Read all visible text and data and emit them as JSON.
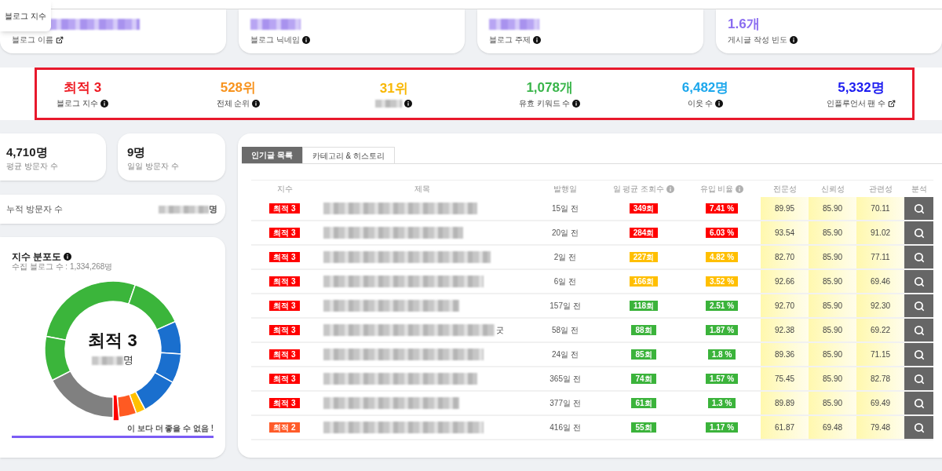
{
  "tooltip": {
    "text": "블로그 지수"
  },
  "blog_info": [
    {
      "label": "블로그 이름",
      "kind": "link",
      "redacted": true
    },
    {
      "label": "블로그 닉네임",
      "kind": "info",
      "redacted": true
    },
    {
      "label": "블로그 주제",
      "kind": "info",
      "redacted": true
    },
    {
      "value": "1.6개",
      "label": "게시글 작성 빈도",
      "kind": "info",
      "redacted": false
    }
  ],
  "stats": [
    {
      "value": "최적 3",
      "label": "블로그 지수",
      "color": "#ee1c24",
      "kind": "info",
      "redacted": false
    },
    {
      "value": "528위",
      "label": "전체 순위",
      "color": "#f7931e",
      "kind": "info",
      "redacted": false
    },
    {
      "value": "31위",
      "color": "#f8b704",
      "kind": "info",
      "redacted": true
    },
    {
      "value": "1,078개",
      "label": "유효 키워드 수",
      "color": "#39b54a",
      "kind": "info",
      "redacted": false
    },
    {
      "value": "6,482명",
      "label": "이웃 수",
      "color": "#1ca7ec",
      "kind": "info",
      "redacted": false
    },
    {
      "value": "5,332명",
      "label": "인플루언서 팬 수",
      "color": "#1b1bf0",
      "kind": "link",
      "redacted": false
    }
  ],
  "visitors": [
    {
      "value": "4,710명",
      "label": "평균 방문자 수"
    },
    {
      "value": "9명",
      "label": "일일 방문자 수"
    }
  ],
  "total_visitors": {
    "label": "누적 방문자 수",
    "unit": "명"
  },
  "distribution": {
    "title": "지수 분포도",
    "subtitle": "수집 블로그 수 : 1,334,268명",
    "center_title": "최적 3",
    "center_unit": "명",
    "message": "이 보다 더 좋을 수 없음 !",
    "level": 1
  },
  "tabs": [
    {
      "label": "인기글 목록",
      "selected": true
    },
    {
      "label": "카테고리 & 히스토리",
      "selected": false
    }
  ],
  "table": {
    "columns": [
      {
        "label": "지수",
        "info": false
      },
      {
        "label": "제목",
        "info": false
      },
      {
        "label": "발행일",
        "info": false
      },
      {
        "label": "일 평균 조회수",
        "info": true
      },
      {
        "label": "유입 비율",
        "info": true
      },
      {
        "label": "전문성",
        "info": false
      },
      {
        "label": "신뢰성",
        "info": false
      },
      {
        "label": "관련성",
        "info": false
      },
      {
        "label": "분석",
        "info": false
      }
    ],
    "rows": [
      {
        "grade": {
          "text": "최적 3",
          "color": "#ff0000"
        },
        "published": "15일 전",
        "views": {
          "text": "349회",
          "color": "#ff0000"
        },
        "ratio": {
          "text": "7.41 %",
          "color": "#ff0000"
        },
        "expertise": "89.95",
        "trust": "85.90",
        "relevance": "70.11"
      },
      {
        "grade": {
          "text": "최적 3",
          "color": "#ff0000"
        },
        "published": "20일 전",
        "views": {
          "text": "284회",
          "color": "#ff0000"
        },
        "ratio": {
          "text": "6.03 %",
          "color": "#ff0000"
        },
        "expertise": "93.54",
        "trust": "85.90",
        "relevance": "91.02"
      },
      {
        "grade": {
          "text": "최적 3",
          "color": "#ff0000"
        },
        "published": "2일 전",
        "views": {
          "text": "227회",
          "color": "#ffbf00"
        },
        "ratio": {
          "text": "4.82 %",
          "color": "#ffbf00"
        },
        "expertise": "82.70",
        "trust": "85.90",
        "relevance": "77.11"
      },
      {
        "grade": {
          "text": "최적 3",
          "color": "#ff0000"
        },
        "published": "6일 전",
        "views": {
          "text": "166회",
          "color": "#ffbf00"
        },
        "ratio": {
          "text": "3.52 %",
          "color": "#ffbf00"
        },
        "expertise": "92.66",
        "trust": "85.90",
        "relevance": "69.46"
      },
      {
        "grade": {
          "text": "최적 3",
          "color": "#ff0000"
        },
        "published": "157일 전",
        "views": {
          "text": "118회",
          "color": "#3bb33b"
        },
        "ratio": {
          "text": "2.51 %",
          "color": "#3bb33b"
        },
        "expertise": "92.70",
        "trust": "85.90",
        "relevance": "92.30"
      },
      {
        "grade": {
          "text": "최적 3",
          "color": "#ff0000"
        },
        "title": "굿",
        "published": "58일 전",
        "views": {
          "text": "88회",
          "color": "#3bb33b"
        },
        "ratio": {
          "text": "1.87 %",
          "color": "#3bb33b"
        },
        "expertise": "92.38",
        "trust": "85.90",
        "relevance": "69.22"
      },
      {
        "grade": {
          "text": "최적 3",
          "color": "#ff0000"
        },
        "published": "24일 전",
        "views": {
          "text": "85회",
          "color": "#3bb33b"
        },
        "ratio": {
          "text": "1.8 %",
          "color": "#3bb33b"
        },
        "expertise": "89.36",
        "trust": "85.90",
        "relevance": "71.15"
      },
      {
        "grade": {
          "text": "최적 3",
          "color": "#ff0000"
        },
        "published": "365일 전",
        "views": {
          "text": "74회",
          "color": "#3bb33b"
        },
        "ratio": {
          "text": "1.57 %",
          "color": "#3bb33b"
        },
        "expertise": "75.45",
        "trust": "85.90",
        "relevance": "82.78"
      },
      {
        "grade": {
          "text": "최적 3",
          "color": "#ff0000"
        },
        "published": "377일 전",
        "views": {
          "text": "61회",
          "color": "#3bb33b"
        },
        "ratio": {
          "text": "1.3 %",
          "color": "#3bb33b"
        },
        "expertise": "89.89",
        "trust": "85.90",
        "relevance": "69.49"
      },
      {
        "grade": {
          "text": "최적 2",
          "color": "#ff5b29"
        },
        "published": "416일 전",
        "views": {
          "text": "55회",
          "color": "#3bb33b"
        },
        "ratio": {
          "text": "1.17 %",
          "color": "#3bb33b"
        },
        "expertise": "61.87",
        "trust": "69.48",
        "relevance": "79.48"
      }
    ]
  }
}
